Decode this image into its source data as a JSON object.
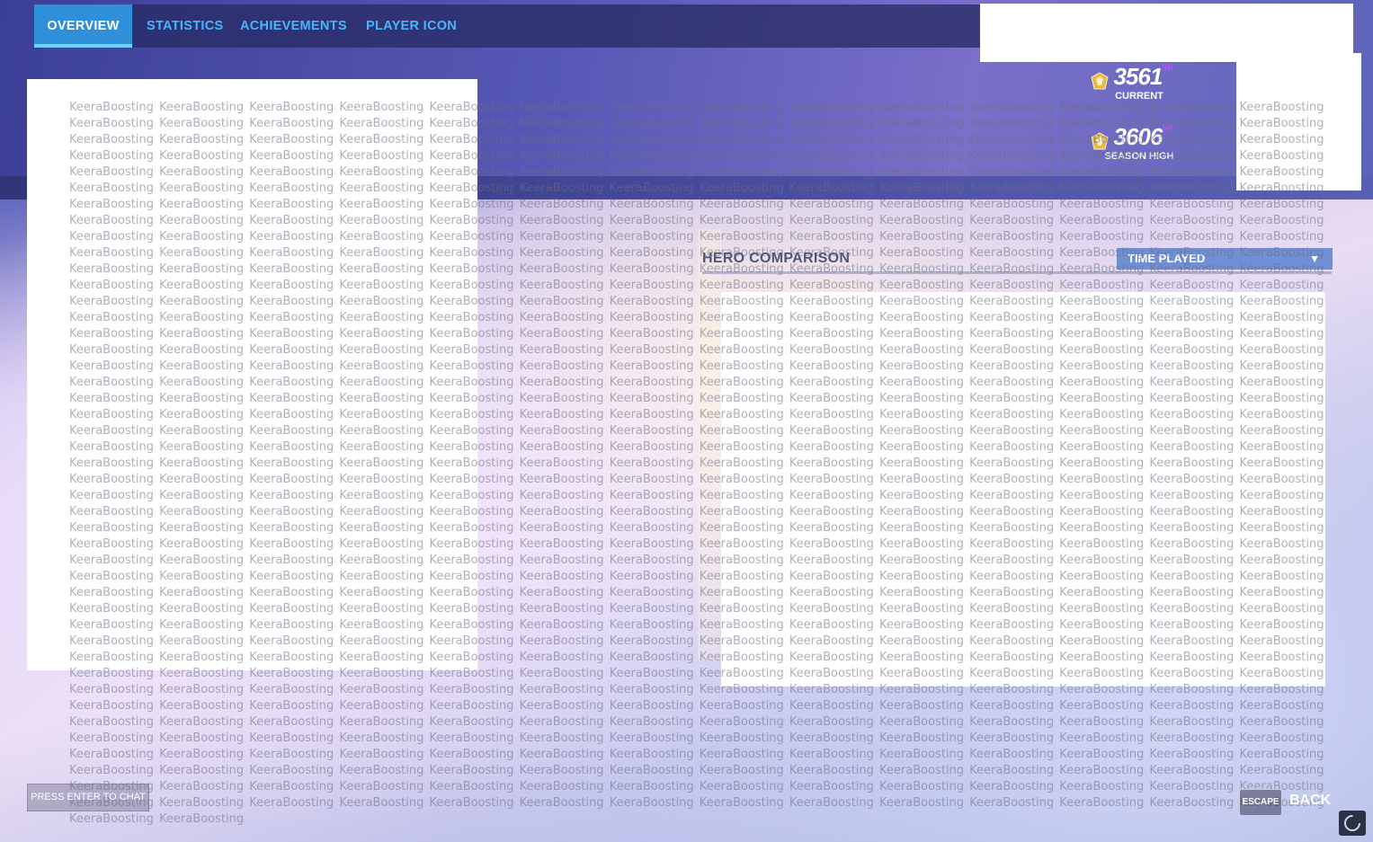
{
  "tabs": [
    {
      "label": "OVERVIEW",
      "active": true
    },
    {
      "label": "STATISTICS",
      "active": false
    },
    {
      "label": "ACHIEVEMENTS",
      "active": false
    },
    {
      "label": "PLAYER ICON",
      "active": false
    }
  ],
  "rank": {
    "current_value": "3561",
    "current_label": "CURRENT",
    "high_value": "3606",
    "high_label": "SEASON HIGH",
    "sr_suffix": "SR"
  },
  "hero_comparison": {
    "title": "HERO COMPARISON",
    "dropdown_value": "TIME PLAYED"
  },
  "watermark_text": "KeeraBoosting",
  "footer": {
    "chat_label": "PRESS ENTER TO CHAT",
    "escape_key": "ESCAPE",
    "back_label": "BACK"
  },
  "colors": {
    "tab_active_bg": "#2f8fd9",
    "tab_text": "#46b7ff",
    "dropdown_bg": "#6f8fd6",
    "sr_accent": "#c24bff"
  },
  "icons": {
    "rank_badge": "master-rank-badge-icon",
    "dropdown_chevron": "chevron-down-icon",
    "loading": "loading-spinner-icon"
  }
}
